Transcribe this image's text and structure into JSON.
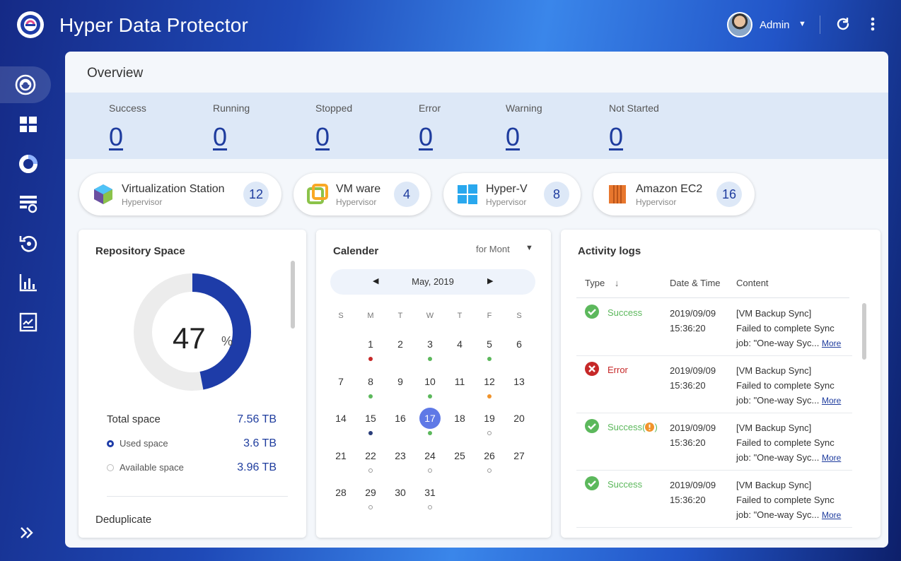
{
  "header": {
    "title": "Hyper Data Protector",
    "user": "Admin"
  },
  "overview": {
    "title": "Overview",
    "statuses": [
      {
        "label": "Success",
        "count": "0"
      },
      {
        "label": "Running",
        "count": "0"
      },
      {
        "label": "Stopped",
        "count": "0"
      },
      {
        "label": "Error",
        "count": "0"
      },
      {
        "label": "Warning",
        "count": "0"
      },
      {
        "label": "Not Started",
        "count": "0"
      }
    ]
  },
  "hypervisors": [
    {
      "name": "Virtualization Station",
      "type": "Hypervisor",
      "count": "12",
      "icon": "virtualization-station-icon"
    },
    {
      "name": "VM ware",
      "type": "Hypervisor",
      "count": "4",
      "icon": "vmware-icon"
    },
    {
      "name": "Hyper-V",
      "type": "Hypervisor",
      "count": "8",
      "icon": "windows-icon"
    },
    {
      "name": "Amazon EC2",
      "type": "Hypervisor",
      "count": "16",
      "icon": "amazon-ec2-icon"
    }
  ],
  "repository": {
    "title": "Repository Space",
    "percent": "47",
    "percent_sign": "%",
    "used_fraction": 0.47,
    "total_label": "Total space",
    "total_value": "7.56 TB",
    "used_label": "Used space",
    "used_value": "3.6 TB",
    "available_label": "Available space",
    "available_value": "3.96 TB",
    "dedup_label": "Deduplicate"
  },
  "calendar": {
    "title": "Calender",
    "range": "for Mont",
    "month": "May, 2019",
    "weekdays": [
      "S",
      "M",
      "T",
      "W",
      "T",
      "F",
      "S"
    ],
    "selected_day": "17",
    "weeks": [
      [
        "",
        "1",
        "2",
        "3",
        "4",
        "5",
        "6"
      ],
      [
        "7",
        "8",
        "9",
        "10",
        "11",
        "12",
        "13"
      ],
      [
        "14",
        "15",
        "16",
        "17",
        "18",
        "19",
        "20"
      ],
      [
        "21",
        "22",
        "23",
        "24",
        "25",
        "26",
        "27"
      ],
      [
        "28",
        "29",
        "30",
        "31",
        "",
        "",
        ""
      ]
    ],
    "markers": {
      "1": "red",
      "3": "green",
      "5": "green",
      "8": "green",
      "10": "green",
      "12": "orange",
      "15": "navy",
      "17": "green",
      "19": "hollow",
      "22": "hollow",
      "24": "hollow",
      "26": "hollow",
      "29": "hollow",
      "31": "hollow"
    }
  },
  "activity": {
    "title": "Activity logs",
    "columns": {
      "type": "Type",
      "date": "Date & Time",
      "content": "Content"
    },
    "more": "More",
    "rows": [
      {
        "status": "success",
        "type": "Success",
        "date": "2019/09/09",
        "time": "15:36:20",
        "line1": "[VM Backup Sync]",
        "line2": "Failed to complete Sync",
        "line3": "job: \"One-way Syc..."
      },
      {
        "status": "error",
        "type": "Error",
        "date": "2019/09/09",
        "time": "15:36:20",
        "line1": "[VM Backup Sync]",
        "line2": "Failed to complete Sync",
        "line3": "job: \"One-way Syc..."
      },
      {
        "status": "success-warning",
        "type": "Success(",
        "type_suffix": ")",
        "date": "2019/09/09",
        "time": "15:36:20",
        "line1": "[VM Backup Sync]",
        "line2": "Failed to complete Sync",
        "line3": "job: \"One-way Syc..."
      },
      {
        "status": "success",
        "type": "Success",
        "date": "2019/09/09",
        "time": "15:36:20",
        "line1": "[VM Backup Sync]",
        "line2": "Failed to complete Sync",
        "line3": "job: \"One-way Syc..."
      }
    ]
  },
  "colors": {
    "accent": "#1e3c9e",
    "success": "#5cb85c",
    "error": "#c62828",
    "warning": "#f0932b",
    "selected_day": "#5f79e6",
    "donut_used": "#1e3ca8",
    "donut_free": "#ececec"
  },
  "sidebar": [
    "overview-icon",
    "dashboard-icon",
    "pie-chart-icon",
    "backup-jobs-icon",
    "restore-icon",
    "reports-icon",
    "logs-icon"
  ]
}
